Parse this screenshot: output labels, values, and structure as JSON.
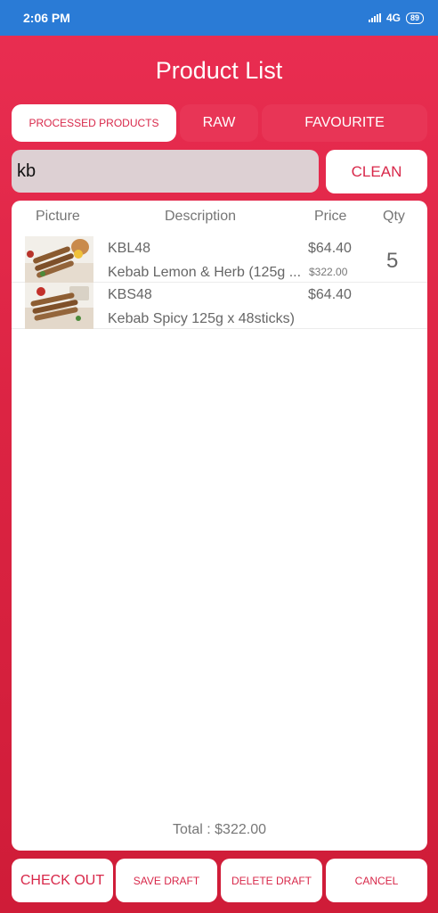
{
  "status_bar": {
    "time": "2:06 PM",
    "network": "4G",
    "battery": "89"
  },
  "title": "Product List",
  "tabs": [
    {
      "label": "PROCESSED PRODUCTS",
      "active": true
    },
    {
      "label": "RAW",
      "active": false
    },
    {
      "label": "FAVOURITE",
      "active": false
    }
  ],
  "search": {
    "value": "kb",
    "clean_label": "CLEAN"
  },
  "table": {
    "headers": {
      "picture": "Picture",
      "description": "Description",
      "price": "Price",
      "qty": "Qty"
    },
    "rows": [
      {
        "code": "KBL48",
        "description": "Kebab Lemon & Herb (125g ...",
        "price": "$64.40",
        "subtotal": "$322.00",
        "qty": "5"
      },
      {
        "code": "KBS48",
        "description": "Kebab Spicy 125g x 48sticks)",
        "price": "$64.40",
        "subtotal": "",
        "qty": ""
      }
    ]
  },
  "total": "Total : $322.00",
  "actions": {
    "checkout": "CHECK OUT",
    "save_draft": "SAVE DRAFT",
    "delete_draft": "DELETE DRAFT",
    "cancel": "CANCEL"
  },
  "colors": {
    "accent": "#d8284a",
    "status_bar": "#2a7bd6",
    "background": "#dc2443"
  },
  "icons": [
    "signal-icon",
    "battery-icon"
  ]
}
